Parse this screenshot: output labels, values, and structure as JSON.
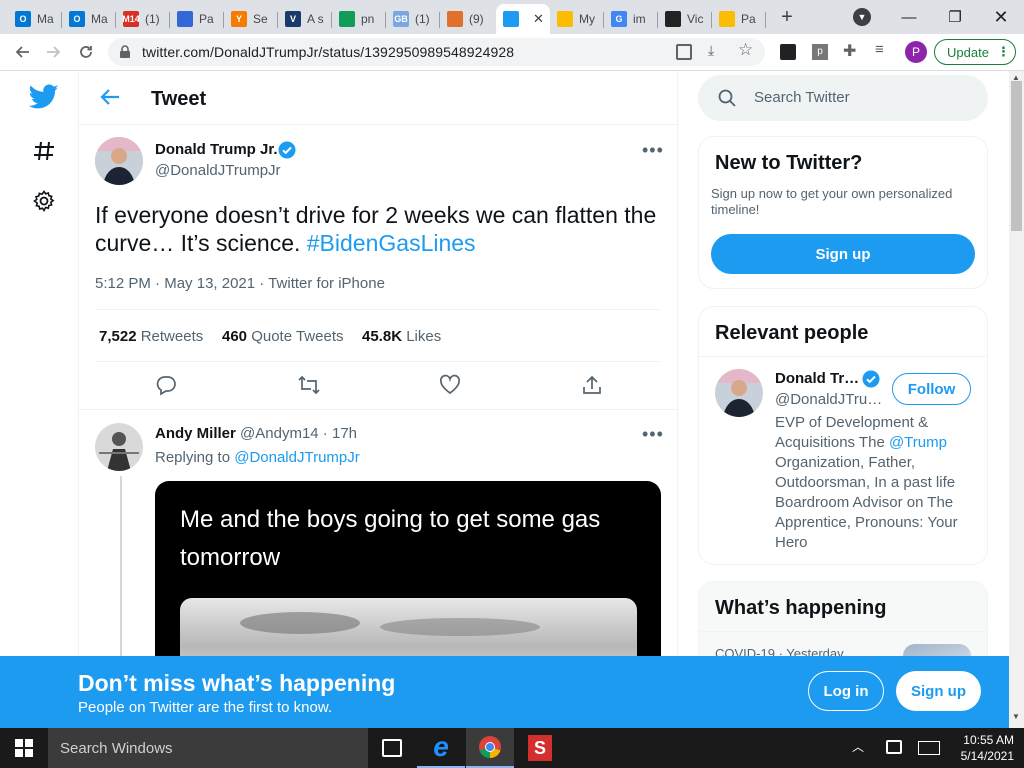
{
  "browser": {
    "tabs": [
      {
        "label": "Ma",
        "color": "#0078d4",
        "glyph": "O"
      },
      {
        "label": "Ma",
        "color": "#0078d4",
        "glyph": "O"
      },
      {
        "label": "(1)",
        "color": "#d93025",
        "glyph": "M14"
      },
      {
        "label": "Pa",
        "color": "#3367d6",
        "glyph": ""
      },
      {
        "label": "Se",
        "color": "#f57c00",
        "glyph": "Y"
      },
      {
        "label": "A s",
        "color": "#1a3a6b",
        "glyph": "V"
      },
      {
        "label": "pn",
        "color": "#0f9d58",
        "glyph": ""
      },
      {
        "label": "(1)",
        "color": "#7aa7e0",
        "glyph": "GB"
      },
      {
        "label": "(9)",
        "color": "#e0702a",
        "glyph": ""
      },
      {
        "label": "",
        "color": "#1d9bf0",
        "glyph": ""
      },
      {
        "label": "My",
        "color": "#fbbc04",
        "glyph": ""
      },
      {
        "label": "im",
        "color": "#4285f4",
        "glyph": "G"
      },
      {
        "label": "Vic",
        "color": "#222222",
        "glyph": ""
      },
      {
        "label": "Pa",
        "color": "#fbbc04",
        "glyph": ""
      }
    ],
    "url": "twitter.com/DonaldJTrumpJr/status/1392950989548924928",
    "update_label": "Update",
    "profile_initial": "P"
  },
  "header": {
    "title": "Tweet"
  },
  "tweet": {
    "author_name": "Donald Trump Jr.",
    "author_handle": "@DonaldJTrumpJr",
    "text": "If everyone doesn’t drive for 2 weeks we can flatten the curve… It’s science. ",
    "hashtag": "#BidenGasLines",
    "time": "5:12 PM",
    "dot1": " · ",
    "date": "May 13, 2021",
    "dot2": " · ",
    "client": "Twitter for iPhone",
    "stats": {
      "retweets_count": "7,522",
      "retweets_label": "Retweets",
      "quotes_count": "460",
      "quotes_label": "Quote Tweets",
      "likes_count": "45.8K",
      "likes_label": "Likes"
    }
  },
  "reply": {
    "author_name": "Andy Miller",
    "author_handle": "@Andym14",
    "time": " · 17h",
    "replying_prefix": "Replying to ",
    "replying_handle": "@DonaldJTrumpJr",
    "meme_text": "Me and the boys going to get some gas tomorrow"
  },
  "sidebar": {
    "search_placeholder": "Search Twitter",
    "new_title": "New to Twitter?",
    "new_desc": "Sign up now to get your own personalized timeline!",
    "signup_label": "Sign up",
    "relevant_title": "Relevant people",
    "person_name": "Donald Tr…",
    "person_handle": "@DonaldJTru…",
    "follow_label": "Follow",
    "bio_before": "EVP of Development & Acquisitions The ",
    "bio_link": "@Trump",
    "bio_after": " Organization, Father, Outdoorsman, In a past life Boardroom Advisor on The Apprentice, Pronouns: Your Hero",
    "happening_title": "What’s happening",
    "happening_meta": "COVID-19 · Yesterday"
  },
  "bottom_bar": {
    "title": "Don’t miss what’s happening",
    "subtitle": "People on Twitter are the first to know.",
    "login_label": "Log in",
    "signup_label": "Sign up"
  },
  "taskbar": {
    "search_placeholder": "Search Windows",
    "time": "10:55 AM",
    "date": "5/14/2021"
  },
  "colors": {
    "twitter_blue": "#1d9bf0",
    "text_primary": "#0f1419",
    "text_secondary": "#536471"
  }
}
